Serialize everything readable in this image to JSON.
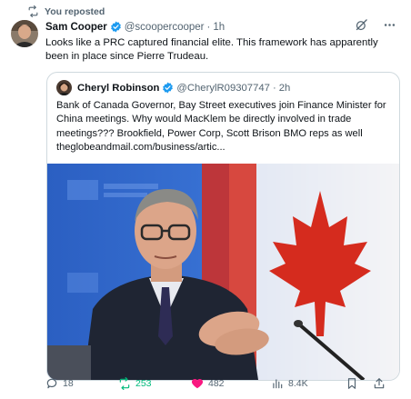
{
  "repost": {
    "label": "You reposted"
  },
  "post": {
    "author_name": "Sam Cooper",
    "handle": "@scoopercooper",
    "separator": "·",
    "time": "1h",
    "text": "Looks like a PRC captured financial elite. This framework has apparently been in place since Pierre Trudeau."
  },
  "quote": {
    "author_name": "Cheryl Robinson",
    "handle": "@CherylR09307747",
    "separator": "·",
    "time": "2h",
    "text": "Bank of Canada Governor, Bay Street executives join Finance Minister for China meetings. Why would MacKlem be directly involved in trade meetings??? Brookfield, Power Corp, Scott Brison BMO reps as well theglobeandmail.com/business/artic..."
  },
  "actions": {
    "replies": "18",
    "reposts": "253",
    "likes": "482",
    "views": "8.4K"
  },
  "colors": {
    "accent_blue": "#1d9bf0",
    "repost_green": "#00ba7c",
    "like_pink": "#f91880",
    "muted": "#536471",
    "flag_red": "#d52b1e",
    "photo_bg_blue": "#2c66c9"
  }
}
